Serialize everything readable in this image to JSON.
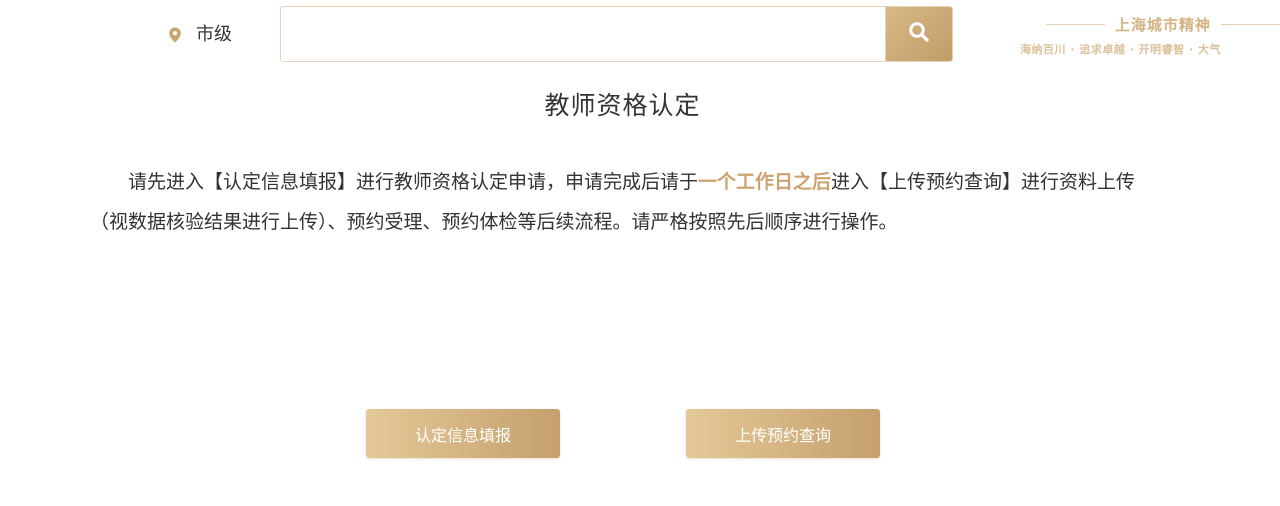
{
  "header": {
    "location": {
      "icon": "location-pin-icon",
      "label": "市级"
    },
    "search": {
      "value": "",
      "placeholder": "",
      "button_icon": "search-icon"
    },
    "slogan": {
      "title": "上海城市精神",
      "subtitle": "海纳百川 · 追求卓越 · 开明睿智 · 大气"
    }
  },
  "main": {
    "title": "教师资格认定",
    "instructions": {
      "part1": "请先进入【认定信息填报】进行教师资格认定申请，申请完成后请于",
      "highlight": "一个工作日之后",
      "part2": "进入【上传预约查询】进行资料上传（视数据核验结果进行上传）、预约受理、预约体检等后续流程。请严格按照先后顺序进行操作。"
    },
    "buttons": {
      "fill_label": "认定信息填报",
      "upload_label": "上传预约查询"
    }
  },
  "colors": {
    "accent": "#c9a46f",
    "accent_light": "#e4c898",
    "highlight_text": "#cca36f",
    "search_border": "#e6d4b6"
  }
}
